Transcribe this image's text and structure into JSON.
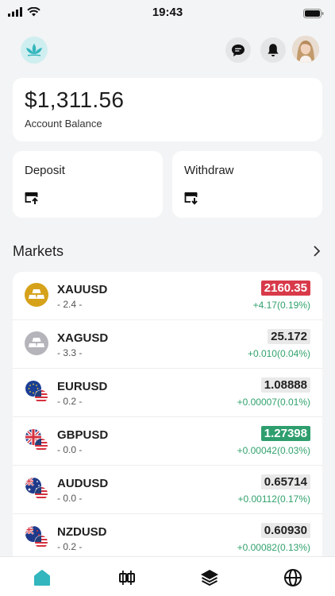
{
  "status": {
    "time": "19:43"
  },
  "balance": {
    "amount": "$1,311.56",
    "label": "Account Balance"
  },
  "actions": {
    "deposit": "Deposit",
    "withdraw": "Withdraw"
  },
  "markets": {
    "title": "Markets",
    "items": [
      {
        "symbol": "XAUUSD",
        "sub": "- 2.4 -",
        "price": "2160.35",
        "change": "+4.17(0.19%)",
        "price_state": "down",
        "icon": "gold-bars-icon"
      },
      {
        "symbol": "XAGUSD",
        "sub": "- 3.3 -",
        "price": "25.172",
        "change": "+0.010(0.04%)",
        "price_state": "neutral",
        "icon": "silver-bars-icon"
      },
      {
        "symbol": "EURUSD",
        "sub": "- 0.2 -",
        "price": "1.08888",
        "change": "+0.00007(0.01%)",
        "price_state": "neutral",
        "icon": "eu-us-flag-icon"
      },
      {
        "symbol": "GBPUSD",
        "sub": "- 0.0 -",
        "price": "1.27398",
        "change": "+0.00042(0.03%)",
        "price_state": "up",
        "icon": "uk-us-flag-icon"
      },
      {
        "symbol": "AUDUSD",
        "sub": "- 0.0 -",
        "price": "0.65714",
        "change": "+0.00112(0.17%)",
        "price_state": "neutral",
        "icon": "au-us-flag-icon"
      },
      {
        "symbol": "NZDUSD",
        "sub": "- 0.2 -",
        "price": "0.60930",
        "change": "+0.00082(0.13%)",
        "price_state": "neutral",
        "icon": "nz-us-flag-icon"
      }
    ]
  },
  "colors": {
    "accent": "#33b6bd",
    "up": "#2f9e6e",
    "down": "#d83a4a",
    "change_text": "#31a26d"
  },
  "tabs": [
    {
      "icon": "home-icon",
      "active": true
    },
    {
      "icon": "candlestick-icon",
      "active": false
    },
    {
      "icon": "layers-icon",
      "active": false
    },
    {
      "icon": "globe-icon",
      "active": false
    }
  ]
}
